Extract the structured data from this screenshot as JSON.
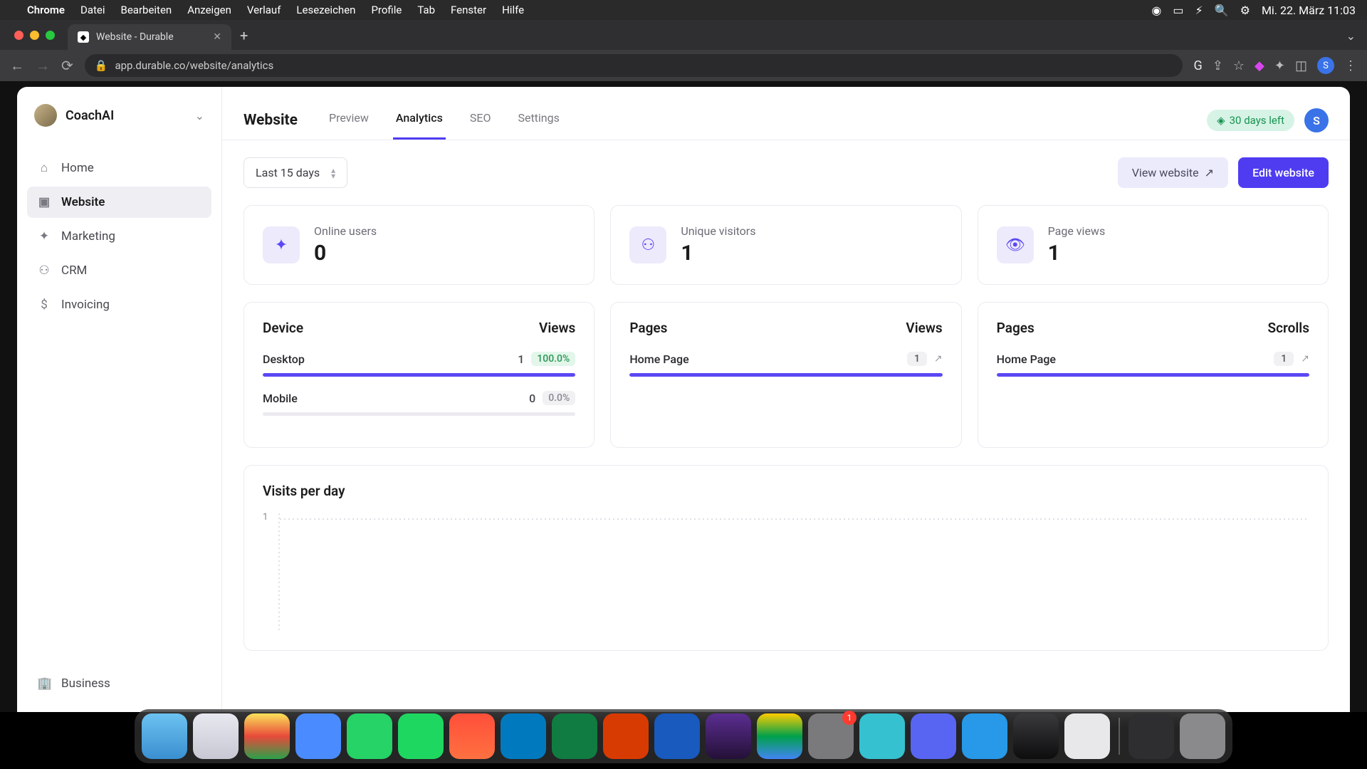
{
  "menubar": {
    "app": "Chrome",
    "items": [
      "Datei",
      "Bearbeiten",
      "Anzeigen",
      "Verlauf",
      "Lesezeichen",
      "Profile",
      "Tab",
      "Fenster",
      "Hilfe"
    ],
    "datetime": "Mi. 22. März  11:03"
  },
  "browser": {
    "tab_title": "Website - Durable",
    "url": "app.durable.co/website/analytics",
    "avatar_initial": "S"
  },
  "sidebar": {
    "org_name": "CoachAI",
    "items": [
      {
        "label": "Home",
        "icon": "⌂"
      },
      {
        "label": "Website",
        "icon": "▣"
      },
      {
        "label": "Marketing",
        "icon": "✦"
      },
      {
        "label": "CRM",
        "icon": "⚇"
      },
      {
        "label": "Invoicing",
        "icon": "$"
      }
    ],
    "bottom": {
      "label": "Business",
      "icon": "🏢"
    },
    "active_index": 1
  },
  "topbar": {
    "title": "Website",
    "tabs": [
      "Preview",
      "Analytics",
      "SEO",
      "Settings"
    ],
    "active_tab_index": 1,
    "trial_label": "30 days left",
    "avatar_initial": "S"
  },
  "toolbar": {
    "date_filter": "Last 15 days",
    "view_website": "View website",
    "edit_website": "Edit website"
  },
  "stats": [
    {
      "label": "Online users",
      "value": "0",
      "icon": "✦"
    },
    {
      "label": "Unique visitors",
      "value": "1",
      "icon": "⚇"
    },
    {
      "label": "Page views",
      "value": "1",
      "icon": "👁"
    }
  ],
  "device_panel": {
    "title": "Device",
    "col": "Views",
    "rows": [
      {
        "label": "Desktop",
        "count": "1",
        "pct": "100.0%",
        "fill": 100
      },
      {
        "label": "Mobile",
        "count": "0",
        "pct": "0.0%",
        "fill": 0
      }
    ]
  },
  "pages_views_panel": {
    "title": "Pages",
    "col": "Views",
    "rows": [
      {
        "label": "Home Page",
        "count": "1",
        "fill": 100
      }
    ]
  },
  "pages_scrolls_panel": {
    "title": "Pages",
    "col": "Scrolls",
    "rows": [
      {
        "label": "Home Page",
        "count": "1",
        "fill": 100
      }
    ]
  },
  "visits_chart": {
    "title": "Visits per day",
    "y_tick": "1"
  },
  "dock": {
    "badge_index": 13,
    "badge_count": "1",
    "colors": [
      "linear-gradient(#6cc2f0,#3a8fd0)",
      "linear-gradient(#e8e8f0,#c8c8d4)",
      "linear-gradient(#fbe25a,#e84a3a,#2aa14a)",
      "#4a8cff",
      "#25d366",
      "#1ed760",
      "linear-gradient(#ff4f3a,#ff7040)",
      "#0079bf",
      "#107c41",
      "#d83b01",
      "#185abd",
      "linear-gradient(#5b2e91,#241037)",
      "linear-gradient(#ffcc00,#00a14b,#4285f4)",
      "#7a7a7c",
      "#35c1d0",
      "#5865f2",
      "#2799e8",
      "linear-gradient(#3a3a3c,#0d0d0e)",
      "#e8e8ea",
      "#2e2e30",
      "#8a8a8c"
    ]
  },
  "colors": {
    "accent": "#4f3cf1"
  }
}
